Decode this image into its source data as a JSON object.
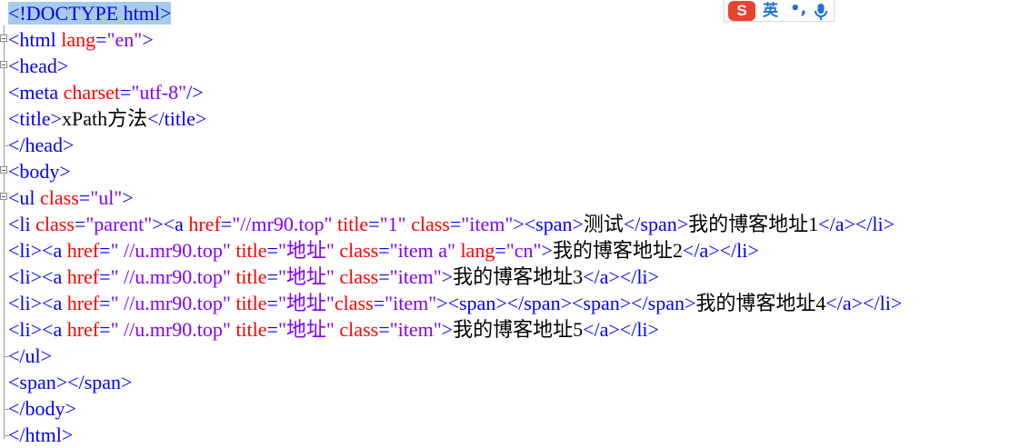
{
  "editor": {
    "lines": [
      [
        {
          "c": "t",
          "s": "<!DOCTYPE html>",
          "sel": true
        }
      ],
      [
        {
          "c": "t",
          "s": "<html "
        },
        {
          "c": "a",
          "s": "lang"
        },
        {
          "c": "t",
          "s": "="
        },
        {
          "c": "v",
          "s": "\"en\""
        },
        {
          "c": "t",
          "s": ">"
        }
      ],
      [
        {
          "c": "t",
          "s": "<head>"
        }
      ],
      [
        {
          "c": "t",
          "s": "<meta "
        },
        {
          "c": "a",
          "s": "charset"
        },
        {
          "c": "t",
          "s": "="
        },
        {
          "c": "v",
          "s": "\"utf-8\""
        },
        {
          "c": "t",
          "s": "/>"
        }
      ],
      [
        {
          "c": "t",
          "s": "<title>"
        },
        {
          "c": "x",
          "s": "xPath方法"
        },
        {
          "c": "t",
          "s": "</title>"
        }
      ],
      [
        {
          "c": "t",
          "s": "</head>"
        }
      ],
      [
        {
          "c": "t",
          "s": "<body>"
        }
      ],
      [
        {
          "c": "t",
          "s": "<ul "
        },
        {
          "c": "a",
          "s": "class"
        },
        {
          "c": "t",
          "s": "="
        },
        {
          "c": "v",
          "s": "\"ul\""
        },
        {
          "c": "t",
          "s": ">"
        }
      ],
      [
        {
          "c": "t",
          "s": "<li "
        },
        {
          "c": "a",
          "s": "class"
        },
        {
          "c": "t",
          "s": "="
        },
        {
          "c": "v",
          "s": "\"parent\""
        },
        {
          "c": "t",
          "s": "><a "
        },
        {
          "c": "a",
          "s": "href"
        },
        {
          "c": "t",
          "s": "="
        },
        {
          "c": "v",
          "s": "\"//mr90.top\""
        },
        {
          "c": "t",
          "s": " "
        },
        {
          "c": "a",
          "s": "title"
        },
        {
          "c": "t",
          "s": "="
        },
        {
          "c": "v",
          "s": "\"1\""
        },
        {
          "c": "t",
          "s": " "
        },
        {
          "c": "a",
          "s": "class"
        },
        {
          "c": "t",
          "s": "="
        },
        {
          "c": "v",
          "s": "\"item\""
        },
        {
          "c": "t",
          "s": "><span>"
        },
        {
          "c": "x",
          "s": "测试"
        },
        {
          "c": "t",
          "s": "</span>"
        },
        {
          "c": "x",
          "s": "我的博客地址1"
        },
        {
          "c": "t",
          "s": "</a></li>"
        }
      ],
      [
        {
          "c": "t",
          "s": "<li><a "
        },
        {
          "c": "a",
          "s": "href"
        },
        {
          "c": "t",
          "s": "="
        },
        {
          "c": "v",
          "s": "\" //u.mr90.top\""
        },
        {
          "c": "t",
          "s": " "
        },
        {
          "c": "a",
          "s": "title"
        },
        {
          "c": "t",
          "s": "="
        },
        {
          "c": "v",
          "s": "\"地址\""
        },
        {
          "c": "t",
          "s": " "
        },
        {
          "c": "a",
          "s": "class"
        },
        {
          "c": "t",
          "s": "="
        },
        {
          "c": "v",
          "s": "\"item a\""
        },
        {
          "c": "t",
          "s": " "
        },
        {
          "c": "a",
          "s": "lang"
        },
        {
          "c": "t",
          "s": "="
        },
        {
          "c": "v",
          "s": "\"cn\""
        },
        {
          "c": "t",
          "s": ">"
        },
        {
          "c": "x",
          "s": "我的博客地址2"
        },
        {
          "c": "t",
          "s": "</a></li>"
        }
      ],
      [
        {
          "c": "t",
          "s": "<li><a "
        },
        {
          "c": "a",
          "s": "href"
        },
        {
          "c": "t",
          "s": "="
        },
        {
          "c": "v",
          "s": "\" //u.mr90.top\""
        },
        {
          "c": "t",
          "s": " "
        },
        {
          "c": "a",
          "s": "title"
        },
        {
          "c": "t",
          "s": "="
        },
        {
          "c": "v",
          "s": "\"地址\""
        },
        {
          "c": "t",
          "s": " "
        },
        {
          "c": "a",
          "s": "class"
        },
        {
          "c": "t",
          "s": "="
        },
        {
          "c": "v",
          "s": "\"item\""
        },
        {
          "c": "t",
          "s": ">"
        },
        {
          "c": "x",
          "s": "我的博客地址3"
        },
        {
          "c": "t",
          "s": "</a></li>"
        }
      ],
      [
        {
          "c": "t",
          "s": "<li><a "
        },
        {
          "c": "a",
          "s": "href"
        },
        {
          "c": "t",
          "s": "="
        },
        {
          "c": "v",
          "s": "\" //u.mr90.top\""
        },
        {
          "c": "t",
          "s": " "
        },
        {
          "c": "a",
          "s": "title"
        },
        {
          "c": "t",
          "s": "="
        },
        {
          "c": "v",
          "s": "\"地址\""
        },
        {
          "c": "a",
          "s": "class"
        },
        {
          "c": "t",
          "s": "="
        },
        {
          "c": "v",
          "s": "\"item\""
        },
        {
          "c": "t",
          "s": "><span></span><span></span>"
        },
        {
          "c": "x",
          "s": "我的博客地址4"
        },
        {
          "c": "t",
          "s": "</a></li>"
        }
      ],
      [
        {
          "c": "t",
          "s": "<li><a "
        },
        {
          "c": "a",
          "s": "href"
        },
        {
          "c": "t",
          "s": "="
        },
        {
          "c": "v",
          "s": "\" //u.mr90.top\""
        },
        {
          "c": "t",
          "s": " "
        },
        {
          "c": "a",
          "s": "title"
        },
        {
          "c": "t",
          "s": "="
        },
        {
          "c": "v",
          "s": "\"地址\""
        },
        {
          "c": "t",
          "s": " "
        },
        {
          "c": "a",
          "s": "class"
        },
        {
          "c": "t",
          "s": "="
        },
        {
          "c": "v",
          "s": "\"item\""
        },
        {
          "c": "t",
          "s": ">"
        },
        {
          "c": "x",
          "s": "我的博客地址5"
        },
        {
          "c": "t",
          "s": "</a></li>"
        }
      ],
      [
        {
          "c": "t",
          "s": "</ul>"
        }
      ],
      [
        {
          "c": "t",
          "s": "<span></span>"
        }
      ],
      [
        {
          "c": "t",
          "s": "</body>"
        }
      ],
      [
        {
          "c": "t",
          "s": "</html>"
        }
      ]
    ]
  },
  "ime": {
    "logo": "S",
    "mode": "英",
    "punct": "•,",
    "mic_icon": "microphone-icon"
  },
  "colors": {
    "tag": "#0000ff",
    "attribute": "#ff0000",
    "value": "#8000ff",
    "text": "#000000",
    "selection": "#a6cbeb"
  }
}
